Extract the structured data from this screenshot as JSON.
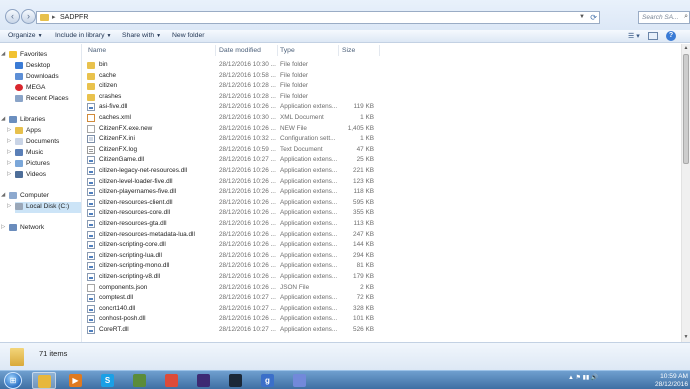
{
  "address": {
    "path": "SADPFR",
    "search_placeholder": "Search SA..."
  },
  "toolbar": {
    "organize": "Organize",
    "include": "Include in library",
    "share": "Share with",
    "new_folder": "New folder"
  },
  "nav": {
    "favorites": "Favorites",
    "desktop": "Desktop",
    "downloads": "Downloads",
    "mega": "MEGA",
    "recent": "Recent Places",
    "libraries": "Libraries",
    "apps": "Apps",
    "documents": "Documents",
    "music": "Music",
    "pictures": "Pictures",
    "videos": "Videos",
    "computer": "Computer",
    "localdisk": "Local Disk (C:)",
    "network": "Network"
  },
  "columns": {
    "name": "Name",
    "date": "Date modified",
    "type": "Type",
    "size": "Size"
  },
  "files": [
    {
      "name": "bin",
      "date": "28/12/2016 10:30 ...",
      "type": "File folder",
      "size": "",
      "icon": "folder"
    },
    {
      "name": "cache",
      "date": "28/12/2016 10:58 ...",
      "type": "File folder",
      "size": "",
      "icon": "folder"
    },
    {
      "name": "citizen",
      "date": "28/12/2016 10:28 ...",
      "type": "File folder",
      "size": "",
      "icon": "folder"
    },
    {
      "name": "crashes",
      "date": "28/12/2016 10:28 ...",
      "type": "File folder",
      "size": "",
      "icon": "folder"
    },
    {
      "name": "asi-five.dll",
      "date": "28/12/2016 10:26 ...",
      "type": "Application extens...",
      "size": "119 KB",
      "icon": "dll"
    },
    {
      "name": "caches.xml",
      "date": "28/12/2016 10:30 ...",
      "type": "XML Document",
      "size": "1 KB",
      "icon": "xml"
    },
    {
      "name": "CitizenFX.exe.new",
      "date": "28/12/2016 10:26 ...",
      "type": "NEW File",
      "size": "1,405 KB",
      "icon": "file"
    },
    {
      "name": "CitizenFX.ini",
      "date": "28/12/2016 10:32 ...",
      "type": "Configuration sett...",
      "size": "1 KB",
      "icon": "ini"
    },
    {
      "name": "CitizenFX.log",
      "date": "28/12/2016 10:59 ...",
      "type": "Text Document",
      "size": "47 KB",
      "icon": "txt"
    },
    {
      "name": "CitizenGame.dll",
      "date": "28/12/2016 10:27 ...",
      "type": "Application extens...",
      "size": "25 KB",
      "icon": "dll"
    },
    {
      "name": "citizen-legacy-net-resources.dll",
      "date": "28/12/2016 10:26 ...",
      "type": "Application extens...",
      "size": "221 KB",
      "icon": "dll"
    },
    {
      "name": "citizen-level-loader-five.dll",
      "date": "28/12/2016 10:26 ...",
      "type": "Application extens...",
      "size": "123 KB",
      "icon": "dll"
    },
    {
      "name": "citizen-playernames-five.dll",
      "date": "28/12/2016 10:26 ...",
      "type": "Application extens...",
      "size": "118 KB",
      "icon": "dll"
    },
    {
      "name": "citizen-resources-client.dll",
      "date": "28/12/2016 10:26 ...",
      "type": "Application extens...",
      "size": "595 KB",
      "icon": "dll"
    },
    {
      "name": "citizen-resources-core.dll",
      "date": "28/12/2016 10:26 ...",
      "type": "Application extens...",
      "size": "355 KB",
      "icon": "dll"
    },
    {
      "name": "citizen-resources-gta.dll",
      "date": "28/12/2016 10:26 ...",
      "type": "Application extens...",
      "size": "113 KB",
      "icon": "dll"
    },
    {
      "name": "citizen-resources-metadata-lua.dll",
      "date": "28/12/2016 10:26 ...",
      "type": "Application extens...",
      "size": "247 KB",
      "icon": "dll"
    },
    {
      "name": "citizen-scripting-core.dll",
      "date": "28/12/2016 10:26 ...",
      "type": "Application extens...",
      "size": "144 KB",
      "icon": "dll"
    },
    {
      "name": "citizen-scripting-lua.dll",
      "date": "28/12/2016 10:26 ...",
      "type": "Application extens...",
      "size": "294 KB",
      "icon": "dll"
    },
    {
      "name": "citizen-scripting-mono.dll",
      "date": "28/12/2016 10:26 ...",
      "type": "Application extens...",
      "size": "81 KB",
      "icon": "dll"
    },
    {
      "name": "citizen-scripting-v8.dll",
      "date": "28/12/2016 10:26 ...",
      "type": "Application extens...",
      "size": "179 KB",
      "icon": "dll"
    },
    {
      "name": "components.json",
      "date": "28/12/2016 10:26 ...",
      "type": "JSON File",
      "size": "2 KB",
      "icon": "file"
    },
    {
      "name": "comptest.dll",
      "date": "28/12/2016 10:27 ...",
      "type": "Application extens...",
      "size": "72 KB",
      "icon": "dll"
    },
    {
      "name": "concrt140.dll",
      "date": "28/12/2016 10:27 ...",
      "type": "Application extens...",
      "size": "328 KB",
      "icon": "dll"
    },
    {
      "name": "conhost-posh.dll",
      "date": "28/12/2016 10:26 ...",
      "type": "Application extens...",
      "size": "101 KB",
      "icon": "dll"
    },
    {
      "name": "CoreRT.dll",
      "date": "28/12/2016 10:27 ...",
      "type": "Application extens...",
      "size": "526 KB",
      "icon": "dll"
    }
  ],
  "details": {
    "count": "71 items"
  },
  "taskbar": {
    "apps": [
      {
        "name": "explorer",
        "glyph": "",
        "color": "#e7b73c",
        "active": true
      },
      {
        "name": "media-player",
        "glyph": "▶",
        "color": "#e07a1f",
        "active": false
      },
      {
        "name": "skype",
        "glyph": "S",
        "color": "#1aa0e6",
        "active": false
      },
      {
        "name": "minecraft",
        "glyph": "",
        "color": "#5b8c3a",
        "active": false
      },
      {
        "name": "chrome",
        "glyph": "",
        "color": "#dd4b39",
        "active": false
      },
      {
        "name": "visual-studio",
        "glyph": "",
        "color": "#3d2a73",
        "active": false
      },
      {
        "name": "steam",
        "glyph": "",
        "color": "#1b2838",
        "active": false
      },
      {
        "name": "gmod",
        "glyph": "g",
        "color": "#3b6fc9",
        "active": false
      },
      {
        "name": "discord",
        "glyph": "",
        "color": "#7289da",
        "active": false
      }
    ],
    "time": "10:59 AM",
    "date": "28/12/2016"
  }
}
